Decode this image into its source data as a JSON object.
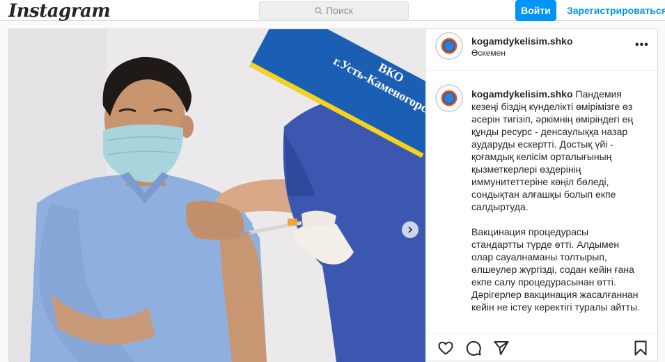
{
  "topbar": {
    "logo": "Instagram",
    "search_placeholder": "Поиск",
    "login_label": "Войти",
    "signup_label": "Зарегистрироваться"
  },
  "photo": {
    "banner_line1": "ВКО",
    "banner_line2": "г.Усть-Каменогорск"
  },
  "post": {
    "username": "kogamdykelisim.shko",
    "location": "Өскемен",
    "caption_paragraphs": [
      "Пандемия кезеңі біздің күнделікті өмірімізге өз әсерін тигізіп, әркімнің өміріндегі ең құнды ресурс - денсаулыққа назар аударуды ескертті. Достық үйі - қоғамдық келісім орталығының қызметкерлері өздерінің иммунитеттеріне көңіл бөледі, сондықтан алғашқы болып екпе салдыртуда.",
      "Вакцинация процедурасы стандартты түрде өтті. Алдымен олар сауалнаманы толтырып, өлшеулер жүргізді, содан кейін ғана екпе салу процедурасынан өтті. Дәрігерлер вакцинация жасалғаннан кейін не істеу керектігі туралы айтты."
    ]
  },
  "icons": {
    "search": "search-icon",
    "next": "chevron-right-icon",
    "more": "more-options-icon",
    "like": "heart-icon",
    "comment": "comment-icon",
    "share": "paper-plane-icon",
    "save": "bookmark-icon"
  }
}
